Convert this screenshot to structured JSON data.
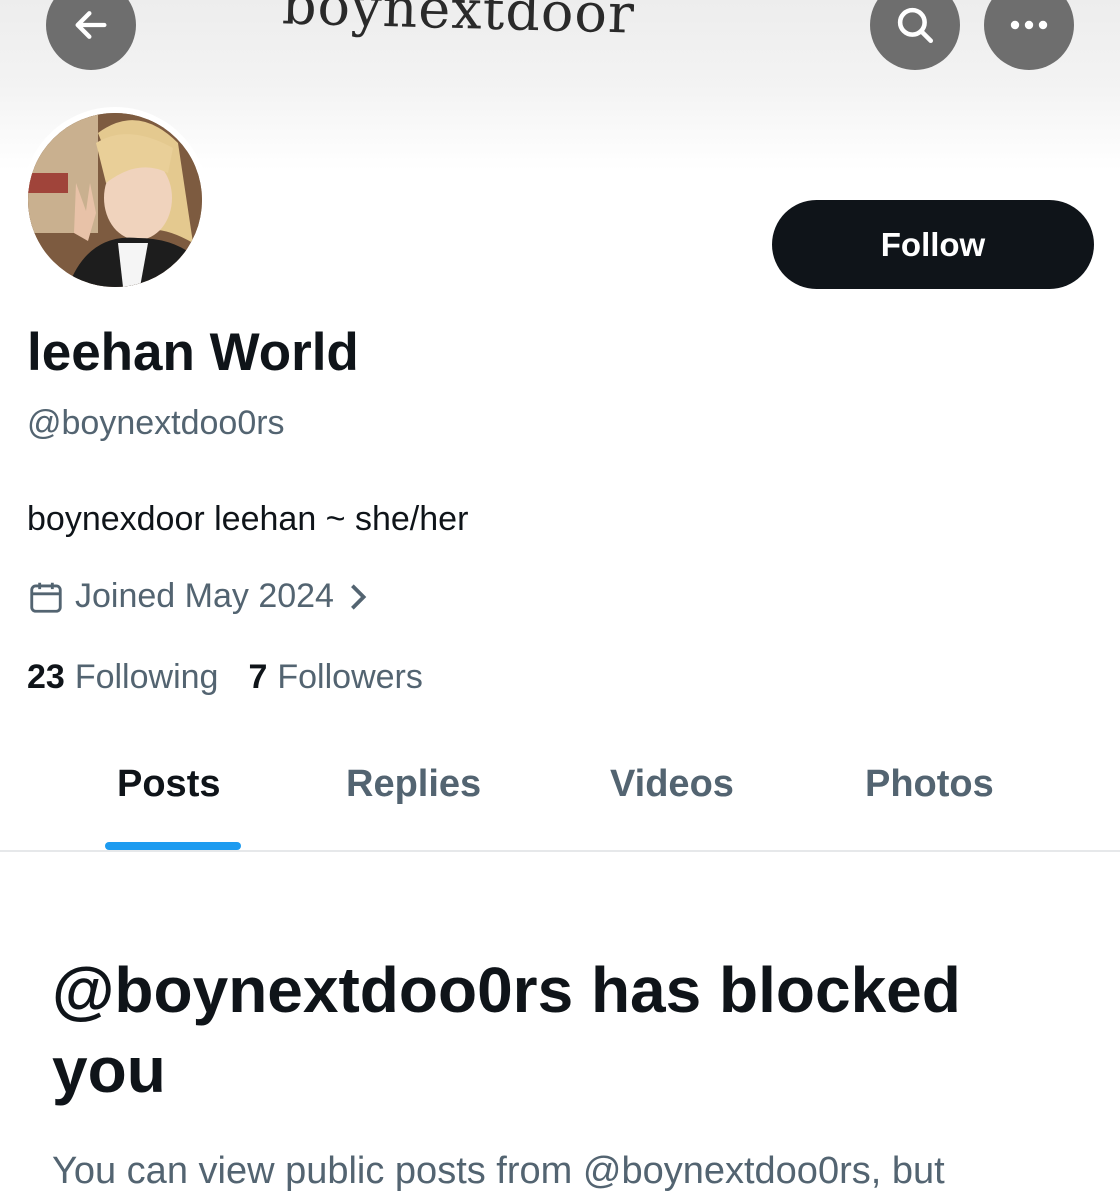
{
  "header": {
    "banner_text": "boynextdoor",
    "back_icon": "arrow-left-icon",
    "search_icon": "search-icon",
    "more_icon": "more-horizontal-icon"
  },
  "profile": {
    "display_name": "leehan World",
    "handle": "@boynextdoo0rs",
    "bio": "boynexdoor leehan ~ she/her",
    "joined": "Joined May 2024",
    "following_count": "23",
    "following_label": "Following",
    "followers_count": "7",
    "followers_label": "Followers",
    "follow_button": "Follow"
  },
  "tabs": [
    {
      "label": "Posts",
      "active": true
    },
    {
      "label": "Replies",
      "active": false
    },
    {
      "label": "Videos",
      "active": false
    },
    {
      "label": "Photos",
      "active": false
    }
  ],
  "blocked": {
    "title": "@boynextdoo0rs has blocked you",
    "description": "You can view public posts from @boynextdoo0rs, but"
  },
  "colors": {
    "accent": "#1d9bf0",
    "text_primary": "#0f1419",
    "text_secondary": "#536471",
    "button_dark": "#0f1419"
  }
}
